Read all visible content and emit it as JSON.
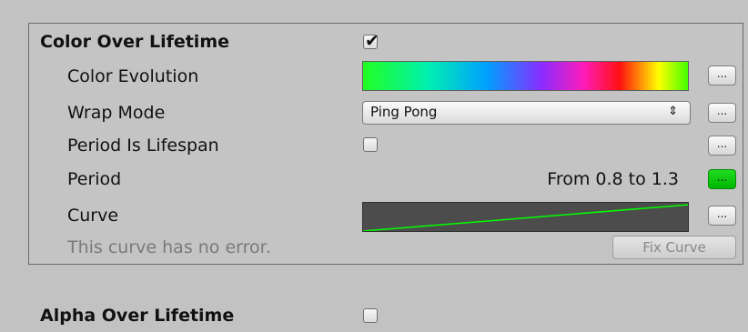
{
  "color_over_lifetime": {
    "title": "Color Over Lifetime",
    "enabled": true,
    "color_evolution": {
      "label": "Color Evolution",
      "button_label": "..."
    },
    "wrap_mode": {
      "label": "Wrap Mode",
      "value": "Ping Pong",
      "button_label": "..."
    },
    "period_is_lifespan": {
      "label": "Period Is Lifespan",
      "checked": false,
      "button_label": "..."
    },
    "period": {
      "label": "Period",
      "value": "From 0.8 to 1.3",
      "button_label": "..."
    },
    "curve": {
      "label": "Curve",
      "button_label": "..."
    },
    "status": "This curve has no error.",
    "fix_button": "Fix Curve"
  },
  "alpha_over_lifetime": {
    "title": "Alpha Over Lifetime",
    "enabled": false
  },
  "colors": {
    "background": "#c2c2c2",
    "active_button": "#00c800",
    "curve_line": "#00ff00",
    "curve_background": "#4c4c4c"
  }
}
